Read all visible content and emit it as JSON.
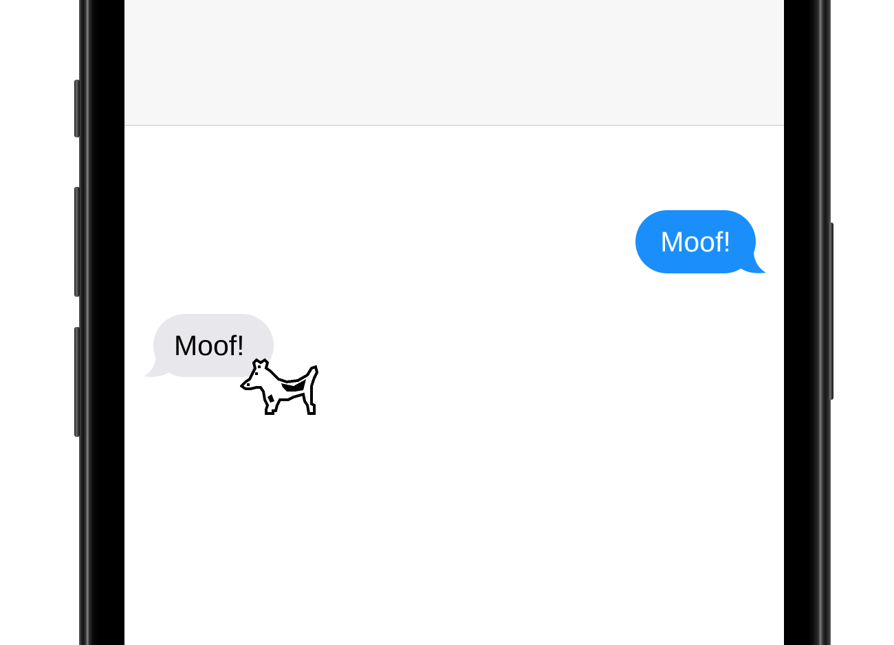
{
  "conversation": {
    "messages": [
      {
        "direction": "sent",
        "text": "Moof!",
        "bubble_color": "#1a8ffb",
        "text_color": "#ffffff"
      },
      {
        "direction": "received",
        "text": "Moof!",
        "bubble_color": "#e7e7ec",
        "text_color": "#000000"
      }
    ],
    "sticker": {
      "icon": "dogcow-icon"
    }
  },
  "colors": {
    "nav_background": "#f7f7f7",
    "thread_background": "#ffffff",
    "frame": "#000000"
  }
}
